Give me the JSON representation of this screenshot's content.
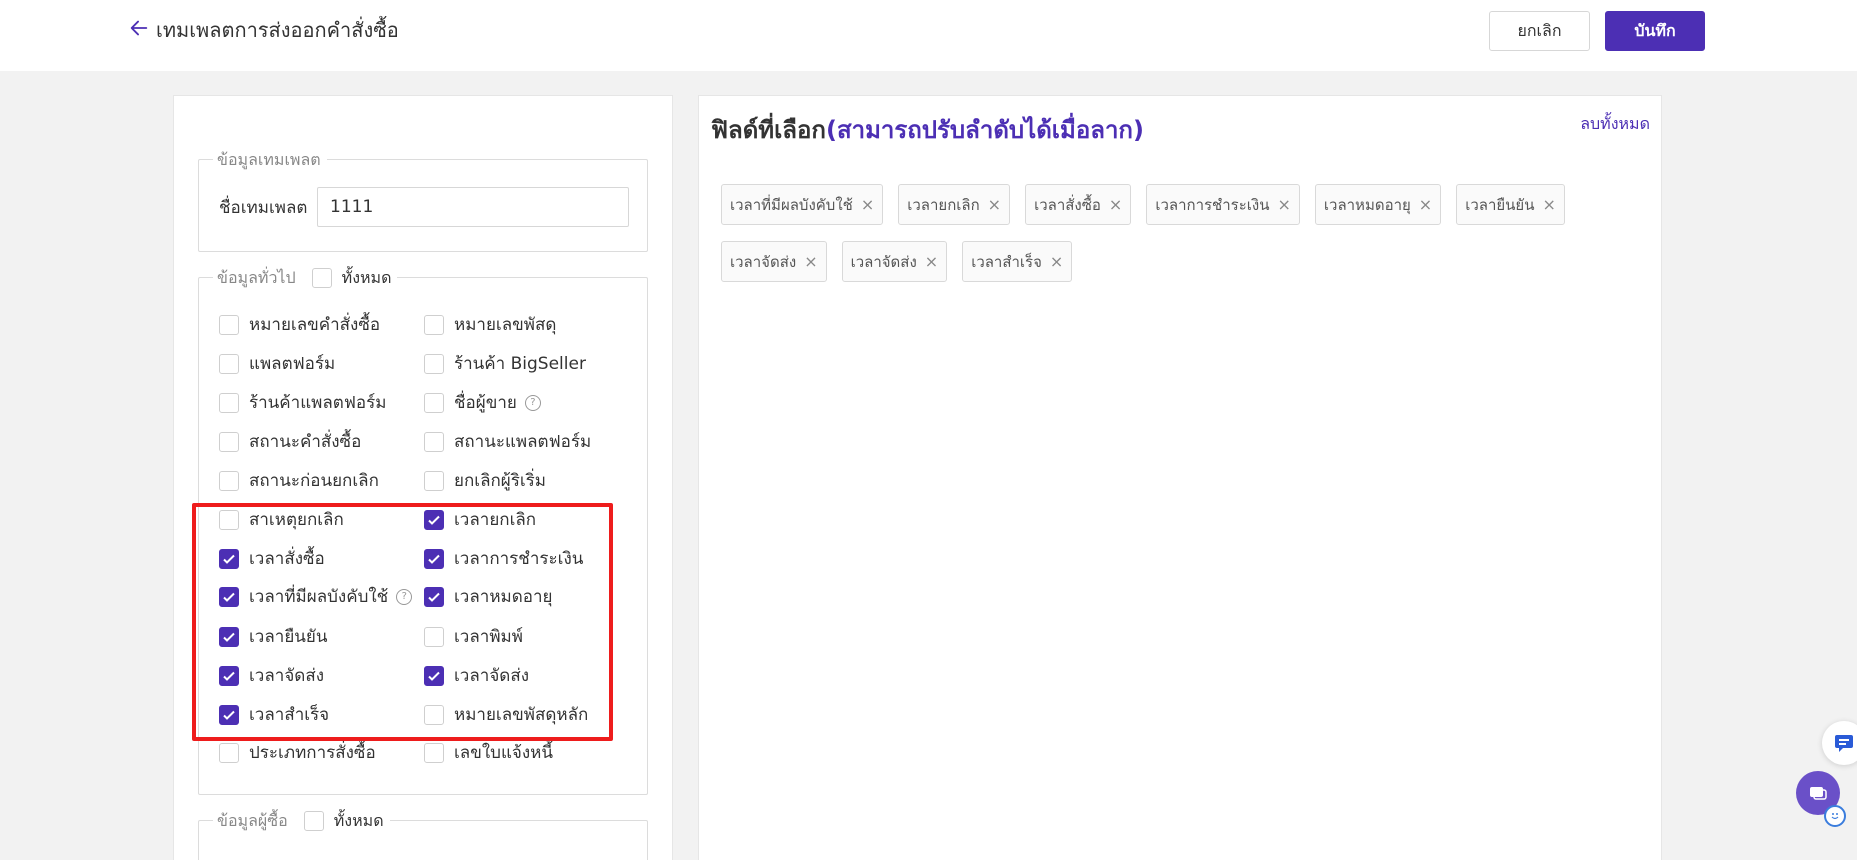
{
  "header": {
    "title": "เทมเพลตการส่งออกคำสั่งซื้อ",
    "cancel_label": "ยกเลิก",
    "save_label": "บันทึก"
  },
  "template_info": {
    "legend": "ข้อมูลเทมเพลต",
    "name_label": "ชื่อเทมเพลต",
    "name_value": "1111"
  },
  "general_info": {
    "legend": "ข้อมูลทั่วไป",
    "select_all_label": "ทั้งหมด",
    "options": [
      {
        "label": "หมายเลขคำสั่งซื้อ",
        "checked": false
      },
      {
        "label": "หมายเลขพัสดุ",
        "checked": false
      },
      {
        "label": "แพลตฟอร์ม",
        "checked": false
      },
      {
        "label": "ร้านค้า BigSeller",
        "checked": false
      },
      {
        "label": "ร้านค้าแพลตฟอร์ม",
        "checked": false
      },
      {
        "label": "ชื่อผู้ขาย",
        "checked": false,
        "help": true
      },
      {
        "label": "สถานะคำสั่งซื้อ",
        "checked": false
      },
      {
        "label": "สถานะแพลตฟอร์ม",
        "checked": false
      },
      {
        "label": "สถานะก่อนยกเลิก",
        "checked": false
      },
      {
        "label": "ยกเลิกผู้ริเริ่ม",
        "checked": false
      },
      {
        "label": "สาเหตุยกเลิก",
        "checked": false
      },
      {
        "label": "เวลายกเลิก",
        "checked": true
      },
      {
        "label": "เวลาสั่งซื้อ",
        "checked": true
      },
      {
        "label": "เวลาการชำระเงิน",
        "checked": true
      },
      {
        "label": "เวลาที่มีผลบังคับใช้",
        "checked": true,
        "help": true
      },
      {
        "label": "เวลาหมดอายุ",
        "checked": true
      },
      {
        "label": "เวลายืนยัน",
        "checked": true
      },
      {
        "label": "เวลาพิมพ์",
        "checked": false
      },
      {
        "label": "เวลาจัดส่ง",
        "checked": true
      },
      {
        "label": "เวลาจัดส่ง",
        "checked": true
      },
      {
        "label": "เวลาสำเร็จ",
        "checked": true
      },
      {
        "label": "หมายเลขพัสดุหลัก",
        "checked": false
      },
      {
        "label": "ประเภทการสั่งซื้อ",
        "checked": false
      },
      {
        "label": "เลขใบแจ้งหนี้",
        "checked": false
      }
    ]
  },
  "buyer_info": {
    "legend": "ข้อมูลผู้ซื้อ",
    "select_all_label": "ทั้งหมด"
  },
  "selected_fields": {
    "title": "ฟิลด์ที่เลือก",
    "subtitle": "(สามารถปรับลำดับได้เมื่อลาก)",
    "clear_all_label": "ลบทั้งหมด",
    "chips": [
      "เวลาที่มีผลบังคับใช้",
      "เวลายกเลิก",
      "เวลาสั่งซื้อ",
      "เวลาการชำระเงิน",
      "เวลาหมดอายุ",
      "เวลายืนยัน",
      "เวลาจัดส่ง",
      "เวลาจัดส่ง",
      "เวลาสำเร็จ"
    ]
  },
  "icons": {
    "back": "arrow-left-icon",
    "check": "check-icon",
    "help": "question-circle-icon",
    "remove": "close-icon",
    "support": "support-icon",
    "chat": "chat-icon"
  },
  "colors": {
    "primary": "#4c2fb4",
    "highlight": "#ee1c1c"
  }
}
